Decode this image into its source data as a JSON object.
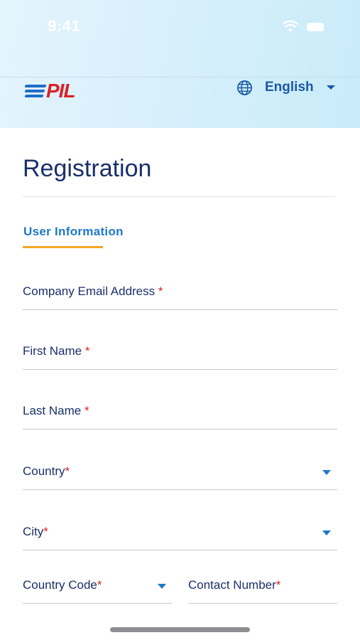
{
  "status_bar": {
    "time": "9:41",
    "icons": [
      "wifi-icon",
      "battery-icon"
    ]
  },
  "header": {
    "logo_text": "PIL",
    "language": {
      "label": "English",
      "icon": "globe-icon",
      "dropdown_icon": "caret-down-icon"
    }
  },
  "colors": {
    "accent": "#1f78c8",
    "brand_red": "#d8232a",
    "tab_underline": "#f4a623",
    "title": "#1a2f6b"
  },
  "page": {
    "title": "Registration"
  },
  "tabs": [
    {
      "label": "User Information",
      "active": true
    }
  ],
  "form": {
    "email": {
      "label": "Company Email Address",
      "required_mark": "*",
      "value": ""
    },
    "first_name": {
      "label": "First Name",
      "required_mark": "*",
      "value": ""
    },
    "last_name": {
      "label": "Last Name",
      "required_mark": "*",
      "value": ""
    },
    "country": {
      "label": "Country",
      "required_mark": "*",
      "value": ""
    },
    "city": {
      "label": "City",
      "required_mark": "*",
      "value": ""
    },
    "country_code": {
      "label": "Country Code",
      "required_mark": "*",
      "value": ""
    },
    "contact_number": {
      "label": "Contact Number",
      "required_mark": "*",
      "value": ""
    }
  }
}
